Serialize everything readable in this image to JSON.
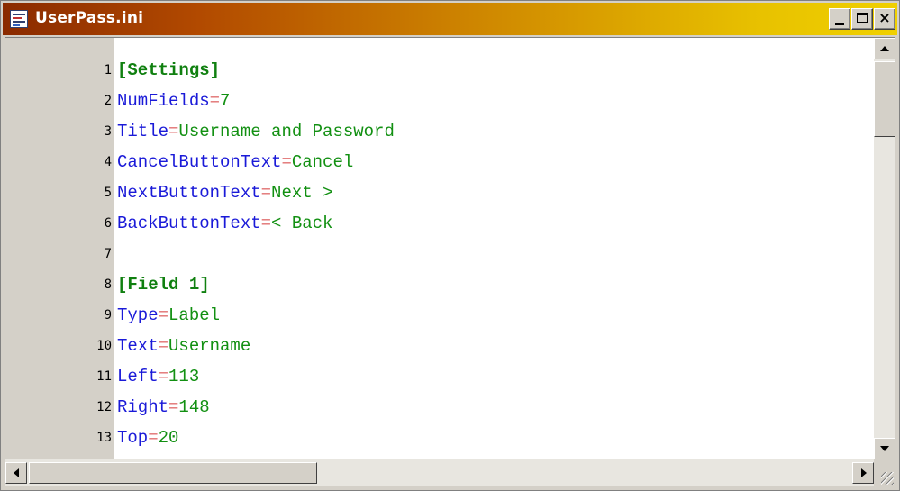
{
  "window": {
    "title": "UserPass.ini",
    "icon": "ini-file-icon",
    "buttons": {
      "minimize": "minimize-icon",
      "maximize": "maximize-icon",
      "close": "close-icon",
      "close_glyph": "×"
    }
  },
  "editor": {
    "lines": [
      {
        "num": "1",
        "type": "section",
        "text": "[Settings]"
      },
      {
        "num": "2",
        "type": "kv",
        "key": "NumFields",
        "eq": "=",
        "value": "7"
      },
      {
        "num": "3",
        "type": "kv",
        "key": "Title",
        "eq": "=",
        "value": "Username and Password"
      },
      {
        "num": "4",
        "type": "kv",
        "key": "CancelButtonText",
        "eq": "=",
        "value": "Cancel"
      },
      {
        "num": "5",
        "type": "kv",
        "key": "NextButtonText",
        "eq": "=",
        "value": "Next >"
      },
      {
        "num": "6",
        "type": "kv",
        "key": "BackButtonText",
        "eq": "=",
        "value": "< Back"
      },
      {
        "num": "7",
        "type": "blank",
        "text": ""
      },
      {
        "num": "8",
        "type": "section",
        "text": "[Field 1]"
      },
      {
        "num": "9",
        "type": "kv",
        "key": "Type",
        "eq": "=",
        "value": "Label"
      },
      {
        "num": "10",
        "type": "kv",
        "key": "Text",
        "eq": "=",
        "value": "Username"
      },
      {
        "num": "11",
        "type": "kv",
        "key": "Left",
        "eq": "=",
        "value": "113"
      },
      {
        "num": "12",
        "type": "kv",
        "key": "Right",
        "eq": "=",
        "value": "148"
      },
      {
        "num": "13",
        "type": "kv",
        "key": "Top",
        "eq": "=",
        "value": "20"
      }
    ]
  },
  "colors": {
    "title_gradient_start": "#8a2a00",
    "title_gradient_end": "#f0d000",
    "key": "#1a1ad8",
    "equals": "#e07070",
    "value": "#129012",
    "section": "#108010"
  }
}
